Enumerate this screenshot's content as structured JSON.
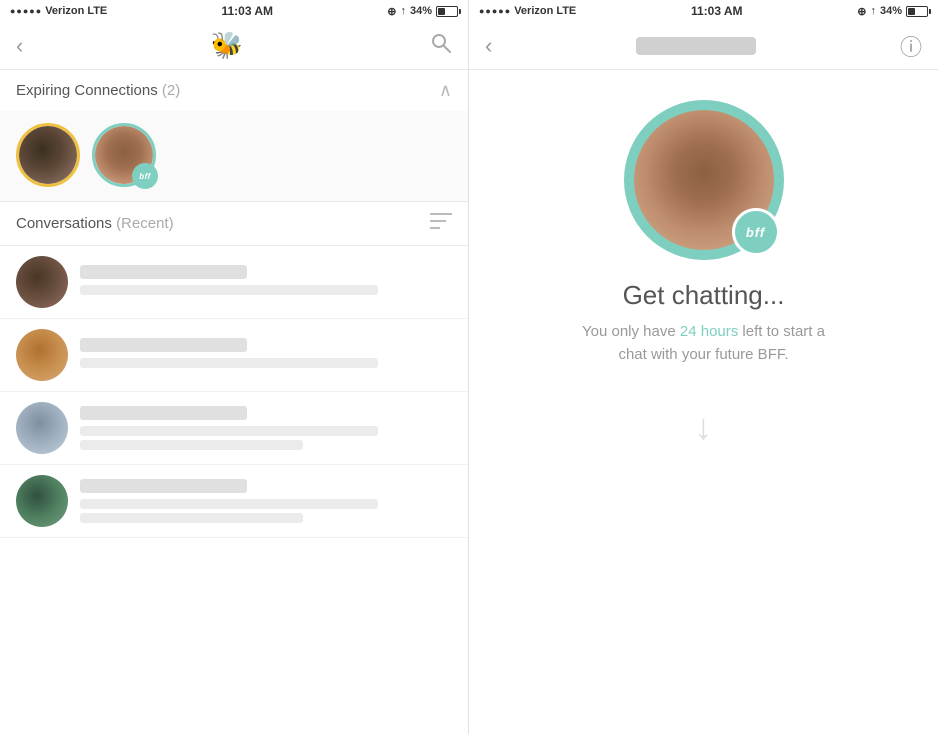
{
  "left": {
    "statusBar": {
      "carrier": "Verizon",
      "network": "LTE",
      "time": "11:03 AM",
      "battery": "34%"
    },
    "nav": {
      "backLabel": "‹",
      "logoSymbol": "🐝",
      "searchLabel": "🔍"
    },
    "expiringSection": {
      "title": "Expiring Connections",
      "count": "(2)",
      "chevron": "∧"
    },
    "conversationsSection": {
      "title": "Conversations",
      "subtitle": "(Recent)",
      "sortIcon": "≡"
    },
    "conversations": [
      {
        "id": 1,
        "faceClass": "conv-face-1"
      },
      {
        "id": 2,
        "faceClass": "conv-face-2"
      },
      {
        "id": 3,
        "faceClass": "conv-face-3"
      },
      {
        "id": 4,
        "faceClass": "conv-face-4"
      }
    ]
  },
  "right": {
    "statusBar": {
      "carrier": "Verizon",
      "network": "LTE",
      "time": "11:03 AM",
      "battery": "34%"
    },
    "nav": {
      "backLabel": "‹",
      "infoLabel": "ⓘ"
    },
    "content": {
      "bffBadge": "bff",
      "title": "Get chatting...",
      "bodyPart1": "You only have ",
      "highlight": "24 hours",
      "bodyPart2": " left to start a",
      "bodyLine2": "chat with your future BFF.",
      "downArrow": "↓"
    }
  }
}
